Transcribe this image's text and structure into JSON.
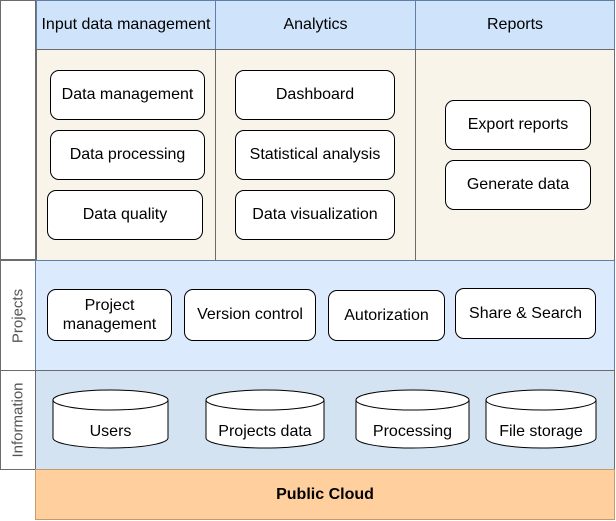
{
  "header": {
    "col1": "Input data management",
    "col2": "Analytics",
    "col3": "Reports"
  },
  "input_data": [
    "Data management",
    "Data processing",
    "Data quality"
  ],
  "analytics": [
    "Dashboard",
    "Statistical analysis",
    "Data visualization"
  ],
  "reports": [
    "Export reports",
    "Generate data"
  ],
  "projects": {
    "label": "Projects",
    "items": [
      "Project management",
      "Version control",
      "Autorization",
      "Share & Search"
    ]
  },
  "information": {
    "label": "Information",
    "items": [
      "Users",
      "Projects data",
      "Processing",
      "File storage"
    ]
  },
  "footer": "Public Cloud"
}
